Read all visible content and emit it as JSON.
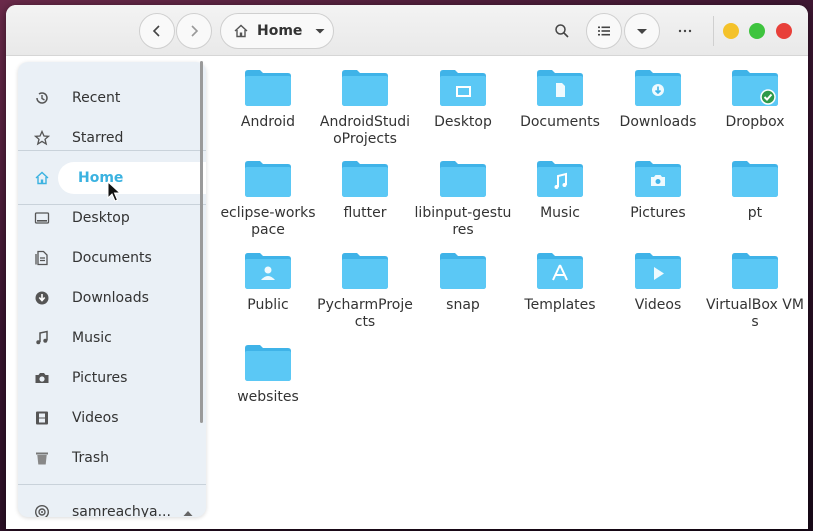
{
  "header": {
    "location_label": "Home",
    "back_icon": "chevron-left-icon",
    "forward_icon": "chevron-right-icon"
  },
  "colors": {
    "accent": "#3bb2e0",
    "folder_body": "#5bc8f5",
    "folder_tab": "#3fb3e8",
    "close": "#e8403a",
    "maximize": "#3ec43e",
    "minimize": "#f4c22a"
  },
  "sidebar": {
    "items": [
      {
        "label": "Recent",
        "icon": "clock-icon"
      },
      {
        "label": "Starred",
        "icon": "star-icon"
      },
      {
        "label": "Home",
        "icon": "home-icon",
        "active": true
      },
      {
        "label": "Desktop",
        "icon": "desktop-icon"
      },
      {
        "label": "Documents",
        "icon": "document-icon"
      },
      {
        "label": "Downloads",
        "icon": "download-icon"
      },
      {
        "label": "Music",
        "icon": "music-icon"
      },
      {
        "label": "Pictures",
        "icon": "camera-icon"
      },
      {
        "label": "Videos",
        "icon": "film-icon"
      },
      {
        "label": "Trash",
        "icon": "trash-icon"
      },
      {
        "label": "samreachya...",
        "icon": "network-drive-icon"
      }
    ]
  },
  "files": [
    {
      "name": "Android",
      "emblem": ""
    },
    {
      "name": "AndroidStudioProjects",
      "emblem": ""
    },
    {
      "name": "Desktop",
      "emblem": "desktop"
    },
    {
      "name": "Documents",
      "emblem": "document"
    },
    {
      "name": "Downloads",
      "emblem": "download"
    },
    {
      "name": "Dropbox",
      "emblem": "check"
    },
    {
      "name": "eclipse-workspace",
      "emblem": ""
    },
    {
      "name": "flutter",
      "emblem": ""
    },
    {
      "name": "libinput-gestures",
      "emblem": ""
    },
    {
      "name": "Music",
      "emblem": "music"
    },
    {
      "name": "Pictures",
      "emblem": "camera"
    },
    {
      "name": "pt",
      "emblem": ""
    },
    {
      "name": "Public",
      "emblem": "person"
    },
    {
      "name": "PycharmProjects",
      "emblem": ""
    },
    {
      "name": "snap",
      "emblem": ""
    },
    {
      "name": "Templates",
      "emblem": "template"
    },
    {
      "name": "Videos",
      "emblem": "play"
    },
    {
      "name": "VirtualBox VMs",
      "emblem": ""
    },
    {
      "name": "websites",
      "emblem": ""
    }
  ]
}
